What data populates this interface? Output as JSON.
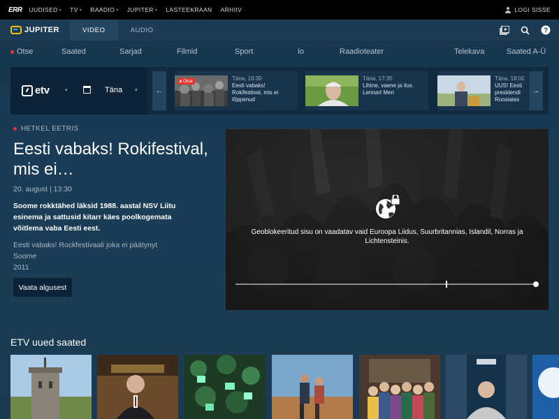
{
  "topbar": {
    "logo": "ERR",
    "nav": [
      {
        "label": "UUDISED",
        "chevron": true
      },
      {
        "label": "TV",
        "chevron": true
      },
      {
        "label": "RAADIO",
        "chevron": true
      },
      {
        "label": "JUPITER",
        "chevron": true
      },
      {
        "label": "LASTEEKRAAN",
        "chevron": false
      },
      {
        "label": "ARHIIV",
        "chevron": false
      }
    ],
    "login_label": "LOGI SISSE"
  },
  "header": {
    "logo_text": "JUPITER",
    "tabs": [
      {
        "label": "VIDEO",
        "active": true
      },
      {
        "label": "AUDIO",
        "active": false
      }
    ],
    "icons": [
      "playlist-icon",
      "search-icon",
      "help-icon"
    ]
  },
  "categories": {
    "items": [
      "Otse",
      "Saated",
      "Sarjad",
      "Filmid",
      "Sport",
      "Io",
      "Raadioteater",
      "Telekava",
      "Saated A-Ü"
    ]
  },
  "schedule": {
    "channel": "etv",
    "day": "Täna",
    "programs": [
      {
        "time": "Täna, 16:30",
        "title": "Eesti vabaks! Rokifestival, mis ei lõppenud",
        "badge": "Otse"
      },
      {
        "time": "Täna, 17:35",
        "title": "Lihtne, vaene ja ilus. Lennart Meri",
        "badge": ""
      },
      {
        "time": "Täna, 18:00",
        "title": "UUS! Eesti presidendi Roosiaias",
        "badge": ""
      }
    ]
  },
  "now_on_air": {
    "label": "HETKEL EETRIS",
    "title": "Eesti vabaks! Rokifestival, mis ei…",
    "date": "20. august | 13:30",
    "description": "Soome rokktähed läksid 1988. aastal NSV Liitu esinema ja sattusid kitarr käes poolkogemata võitlema vaba Eesti eest.",
    "original_title": "Eesti vabaks! Rockfestivaali joka ei päätynyt",
    "country": "Soome",
    "year": "2011",
    "watch_button": "Vaata algusest"
  },
  "player": {
    "geoblock_message": "Geoblokeeritud sisu on vaadatav vaid Euroopa Liidus, Suurbritannias, Islandil, Norras ja Lichtensteinis.",
    "progress": 0.7
  },
  "new_shows": {
    "title": "ETV uued saated"
  },
  "colors": {
    "background": "#1a3d57",
    "live_red": "#e8352e",
    "jupiter_yellow": "#f5c400"
  }
}
